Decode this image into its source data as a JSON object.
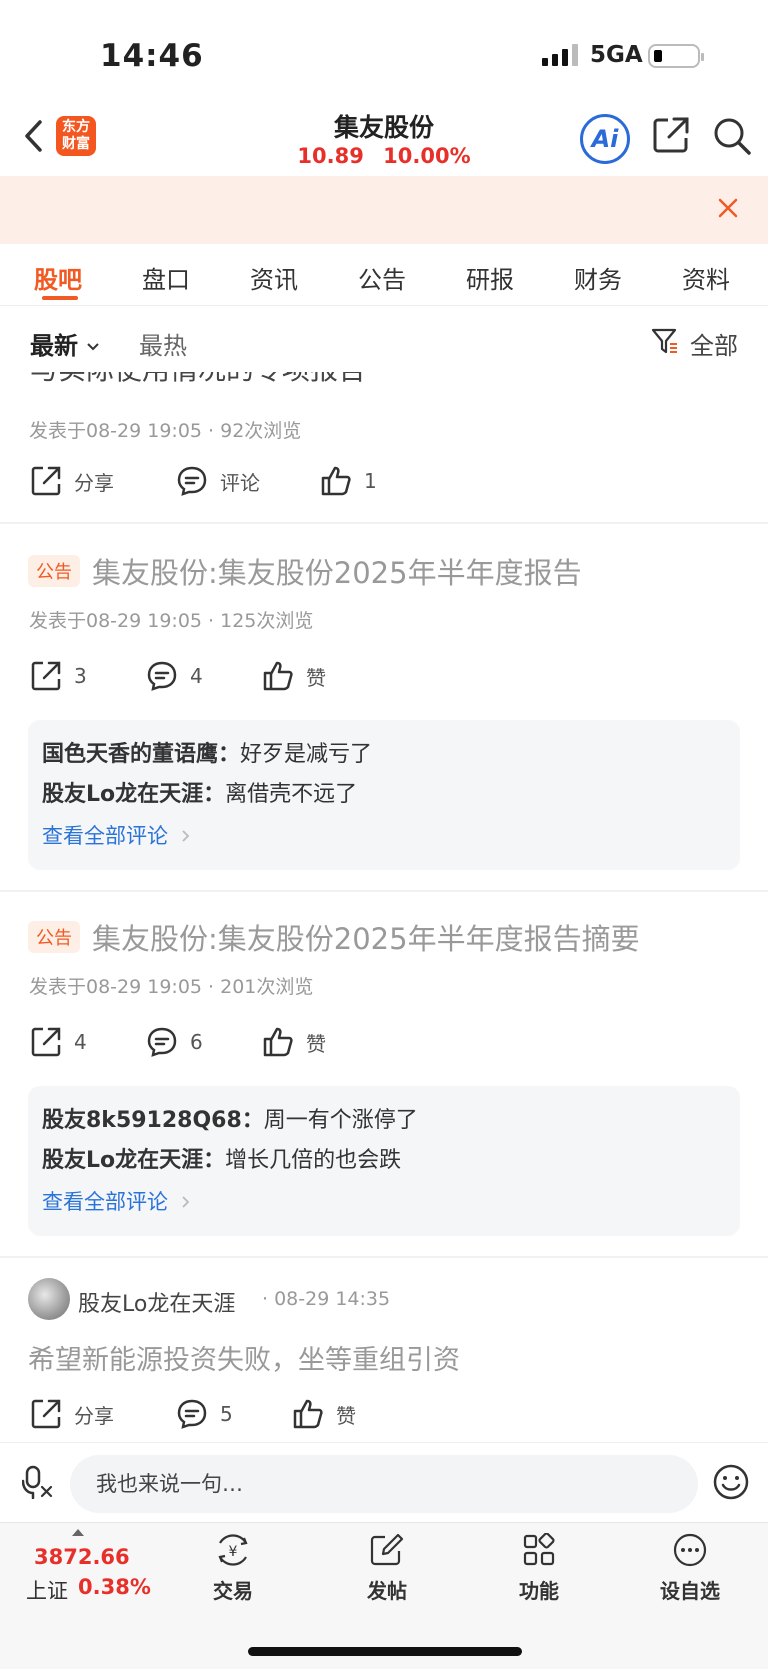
{
  "status": {
    "time": "14:46",
    "network": "5GA"
  },
  "header": {
    "logo_line1": "东方",
    "logo_line2": "财富",
    "title": "集友股份",
    "price": "10.89",
    "change_pct": "10.00%",
    "ai_label": "Ai"
  },
  "tabs": [
    "股吧",
    "盘口",
    "资讯",
    "公告",
    "研报",
    "财务",
    "资料"
  ],
  "filter": {
    "latest": "最新",
    "hot": "最热",
    "all": "全部"
  },
  "feed": {
    "partial": {
      "title_tail": "与实际使用情况的专项报告",
      "meta": "发表于08-29 19:05 · 92次浏览",
      "share": "分享",
      "comment": "评论",
      "like": "1"
    },
    "posts": [
      {
        "tag": "公告",
        "title": "集友股份:集友股份2025年半年度报告",
        "meta": "发表于08-29 19:05 · 125次浏览",
        "shares": "3",
        "comments": "4",
        "like": "赞",
        "replies": [
          {
            "user": "国色天香的董语鹰：",
            "text": "好歹是减亏了"
          },
          {
            "user": "股友Lo龙在天涯：",
            "text": "离借壳不远了"
          }
        ],
        "more": "查看全部评论"
      },
      {
        "tag": "公告",
        "title": "集友股份:集友股份2025年半年度报告摘要",
        "meta": "发表于08-29 19:05 · 201次浏览",
        "shares": "4",
        "comments": "6",
        "like": "赞",
        "replies": [
          {
            "user": "股友8k59128Q68：",
            "text": "周一有个涨停了"
          },
          {
            "user": "股友Lo龙在天涯：",
            "text": "增长几倍的也会跌"
          }
        ],
        "more": "查看全部评论"
      }
    ],
    "user_post": {
      "name": "股友Lo龙在天涯",
      "time": "· 08-29 14:35",
      "text": "希望新能源投资失败，坐等重组引资",
      "share": "分享",
      "comments": "5",
      "like": "赞"
    }
  },
  "input": {
    "placeholder": "我也来说一句…"
  },
  "bottom": {
    "index_value": "3872.66",
    "index_name": "上证",
    "index_pct": "0.38%",
    "nav": [
      "交易",
      "发帖",
      "功能",
      "设自选"
    ]
  },
  "colors": {
    "accent": "#f15a22",
    "up": "#e8302a",
    "link": "#2a73d8",
    "ai": "#2a6ad9"
  }
}
